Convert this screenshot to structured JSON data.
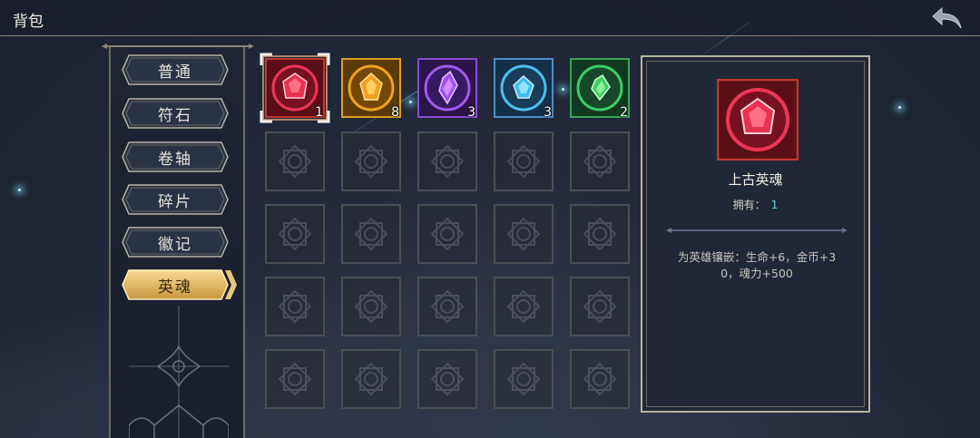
{
  "header": {
    "title": "背包",
    "back_icon": "back-arrow-icon"
  },
  "tabs": [
    {
      "label": "普通",
      "active": false
    },
    {
      "label": "符石",
      "active": false
    },
    {
      "label": "卷轴",
      "active": false
    },
    {
      "label": "碎片",
      "active": false
    },
    {
      "label": "徽记",
      "active": false
    },
    {
      "label": "英魂",
      "active": true
    }
  ],
  "items": [
    {
      "icon": "red-gem-icon",
      "count": "1",
      "rarity_color": "#c0392b",
      "gem_color": "#ff3b5c",
      "selected": true
    },
    {
      "icon": "orange-gem-icon",
      "count": "8",
      "rarity_color": "#e0a020",
      "gem_color": "#ffb020",
      "selected": false
    },
    {
      "icon": "purple-gem-icon",
      "count": "3",
      "rarity_color": "#8a4bd6",
      "gem_color": "#b060ff",
      "selected": false
    },
    {
      "icon": "blue-gem-icon",
      "count": "3",
      "rarity_color": "#4a90c8",
      "gem_color": "#50d0ff",
      "selected": false
    },
    {
      "icon": "green-gem-icon",
      "count": "2",
      "rarity_color": "#3aa55a",
      "gem_color": "#40e070",
      "selected": false
    }
  ],
  "detail": {
    "icon": "red-gem-icon",
    "name": "上古英魂",
    "own_label": "拥有：",
    "own_value": "1",
    "description": "为英雄镶嵌：生命+6，金币+30，魂力+500"
  },
  "colors": {
    "accent_gold": "#e7c878",
    "frame": "#b9b3a1",
    "own_value": "#5fd0f5"
  }
}
